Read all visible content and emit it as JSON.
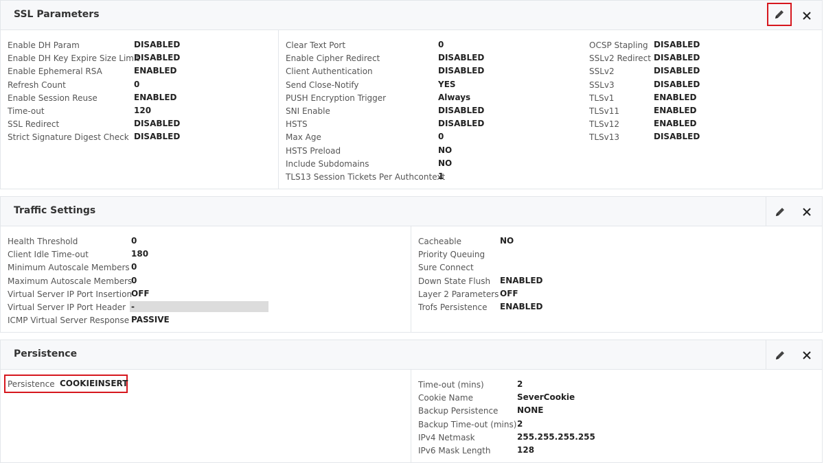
{
  "ssl": {
    "title": "SSL Parameters",
    "col1": [
      {
        "label": "Enable DH Param",
        "value": "DISABLED"
      },
      {
        "label": "Enable DH Key Expire Size Limit",
        "value": "DISABLED"
      },
      {
        "label": "Enable Ephemeral RSA",
        "value": "ENABLED"
      },
      {
        "label": "Refresh Count",
        "value": "0"
      },
      {
        "label": "Enable Session Reuse",
        "value": "ENABLED"
      },
      {
        "label": "Time-out",
        "value": "120"
      },
      {
        "label": "SSL Redirect",
        "value": "DISABLED"
      },
      {
        "label": "Strict Signature Digest Check",
        "value": "DISABLED"
      }
    ],
    "col2": [
      {
        "label": "Clear Text Port",
        "value": "0"
      },
      {
        "label": "Enable Cipher Redirect",
        "value": "DISABLED"
      },
      {
        "label": "Client Authentication",
        "value": "DISABLED"
      },
      {
        "label": "Send Close-Notify",
        "value": "YES"
      },
      {
        "label": "PUSH Encryption Trigger",
        "value": "Always"
      },
      {
        "label": "SNI Enable",
        "value": "DISABLED"
      },
      {
        "label": "HSTS",
        "value": "DISABLED"
      },
      {
        "label": "Max Age",
        "value": "0"
      },
      {
        "label": "HSTS Preload",
        "value": "NO"
      },
      {
        "label": "Include Subdomains",
        "value": "NO"
      },
      {
        "label": "TLS13 Session Tickets Per Authcontext",
        "value": "1"
      }
    ],
    "col3": [
      {
        "label": "OCSP Stapling",
        "value": "DISABLED"
      },
      {
        "label": "SSLv2 Redirect",
        "value": "DISABLED"
      },
      {
        "label": "SSLv2",
        "value": "DISABLED"
      },
      {
        "label": "SSLv3",
        "value": "DISABLED"
      },
      {
        "label": "TLSv1",
        "value": "ENABLED"
      },
      {
        "label": "TLSv11",
        "value": "ENABLED"
      },
      {
        "label": "TLSv12",
        "value": "ENABLED"
      },
      {
        "label": "TLSv13",
        "value": "DISABLED"
      }
    ]
  },
  "traffic": {
    "title": "Traffic Settings",
    "col1": [
      {
        "label": "Health Threshold",
        "value": "0"
      },
      {
        "label": "Client Idle Time-out",
        "value": "180"
      },
      {
        "label": "Minimum Autoscale Members",
        "value": "0"
      },
      {
        "label": "Maximum Autoscale Members",
        "value": "0"
      },
      {
        "label": "Virtual Server IP Port Insertion",
        "value": "OFF"
      },
      {
        "label": "Virtual Server IP Port Header",
        "value": "-"
      },
      {
        "label": "ICMP Virtual Server Response",
        "value": "PASSIVE"
      }
    ],
    "col2": [
      {
        "label": "Cacheable",
        "value": "NO"
      },
      {
        "label": "Priority Queuing",
        "value": ""
      },
      {
        "label": "Sure Connect",
        "value": ""
      },
      {
        "label": "Down State Flush",
        "value": "ENABLED"
      },
      {
        "label": "Layer 2 Parameters",
        "value": "OFF"
      },
      {
        "label": "Trofs Persistence",
        "value": "ENABLED"
      }
    ]
  },
  "persistence": {
    "title": "Persistence",
    "main": {
      "label": "Persistence",
      "value": "COOKIEINSERT"
    },
    "col2": [
      {
        "label": "Time-out (mins)",
        "value": "2"
      },
      {
        "label": "Cookie Name",
        "value": "SeverCookie"
      },
      {
        "label": "Backup Persistence",
        "value": "NONE"
      },
      {
        "label": "Backup Time-out (mins)",
        "value": "2"
      },
      {
        "label": "IPv4 Netmask",
        "value": "255.255.255.255"
      },
      {
        "label": "IPv6 Mask Length",
        "value": "128"
      }
    ]
  },
  "icons": {
    "edit": "pencil-icon",
    "close": "close-icon"
  },
  "colors": {
    "highlight": "#d6161d",
    "header_bg": "#f7f8fa",
    "border": "#e3e6ea"
  }
}
